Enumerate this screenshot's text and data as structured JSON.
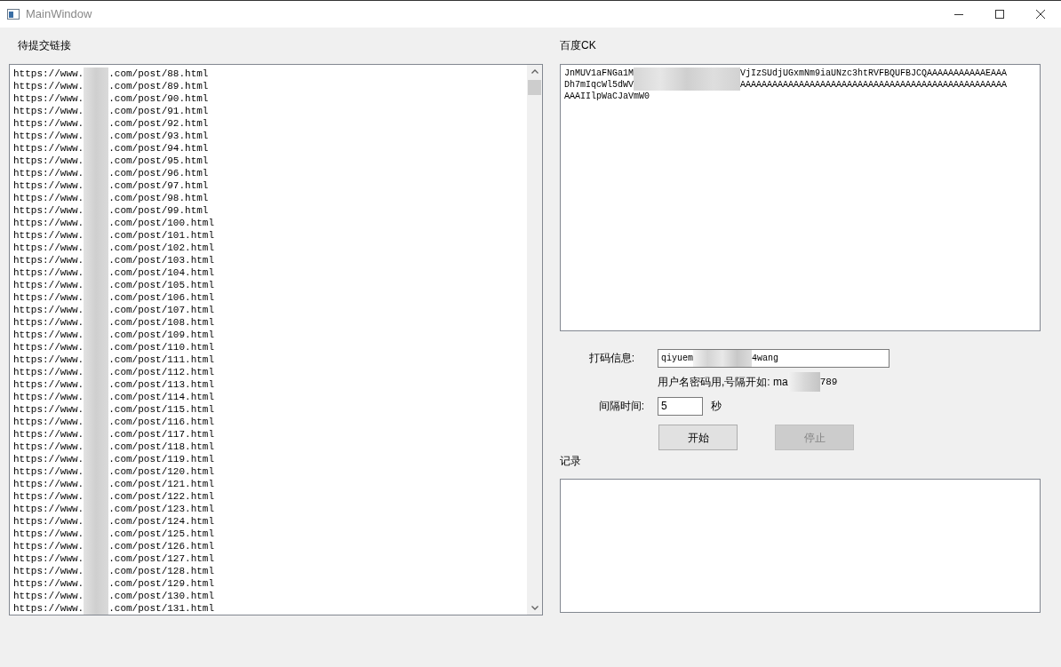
{
  "window": {
    "title": "MainWindow"
  },
  "links_panel": {
    "label": "待提交链接",
    "lines": [
      {
        "before": "https://www.",
        "after": ".com/post/88.html"
      },
      {
        "before": "https://www.",
        "after": ".com/post/89.html"
      },
      {
        "before": "https://www.",
        "after": ".com/post/90.html"
      },
      {
        "before": "https://www.",
        "after": ".com/post/91.html"
      },
      {
        "before": "https://www.",
        "after": ".com/post/92.html"
      },
      {
        "before": "https://www.",
        "after": ".com/post/93.html"
      },
      {
        "before": "https://www.",
        "after": ".com/post/94.html"
      },
      {
        "before": "https://www.",
        "after": ".com/post/95.html"
      },
      {
        "before": "https://www.",
        "after": ".com/post/96.html"
      },
      {
        "before": "https://www.",
        "after": ".com/post/97.html"
      },
      {
        "before": "https://www.",
        "after": ".com/post/98.html"
      },
      {
        "before": "https://www.",
        "after": ".com/post/99.html"
      },
      {
        "before": "https://www.",
        "after": ".com/post/100.html"
      },
      {
        "before": "https://www.",
        "after": ".com/post/101.html"
      },
      {
        "before": "https://www.",
        "after": ".com/post/102.html"
      },
      {
        "before": "https://www.",
        "after": ".com/post/103.html"
      },
      {
        "before": "https://www.",
        "after": ".com/post/104.html"
      },
      {
        "before": "https://www.",
        "after": ".com/post/105.html"
      },
      {
        "before": "https://www.",
        "after": ".com/post/106.html"
      },
      {
        "before": "https://www.",
        "after": ".com/post/107.html"
      },
      {
        "before": "https://www.",
        "after": ".com/post/108.html"
      },
      {
        "before": "https://www.",
        "after": ".com/post/109.html"
      },
      {
        "before": "https://www.",
        "after": ".com/post/110.html"
      },
      {
        "before": "https://www.",
        "after": ".com/post/111.html"
      },
      {
        "before": "https://www.",
        "after": ".com/post/112.html"
      },
      {
        "before": "https://www.",
        "after": ".com/post/113.html"
      },
      {
        "before": "https://www.",
        "after": ".com/post/114.html"
      },
      {
        "before": "https://www.",
        "after": ".com/post/115.html"
      },
      {
        "before": "https://www.",
        "after": ".com/post/116.html"
      },
      {
        "before": "https://www.",
        "after": ".com/post/117.html"
      },
      {
        "before": "https://www.",
        "after": ".com/post/118.html"
      },
      {
        "before": "https://www.",
        "after": ".com/post/119.html"
      },
      {
        "before": "https://www.",
        "after": ".com/post/120.html"
      },
      {
        "before": "https://www.",
        "after": ".com/post/121.html"
      },
      {
        "before": "https://www.",
        "after": ".com/post/122.html"
      },
      {
        "before": "https://www.",
        "after": ".com/post/123.html"
      },
      {
        "before": "https://www.",
        "after": ".com/post/124.html"
      },
      {
        "before": "https://www.",
        "after": ".com/post/125.html"
      },
      {
        "before": "https://www.",
        "after": ".com/post/126.html"
      },
      {
        "before": "https://www.",
        "after": ".com/post/127.html"
      },
      {
        "before": "https://www.",
        "after": ".com/post/128.html"
      },
      {
        "before": "https://www.",
        "after": ".com/post/129.html"
      },
      {
        "before": "https://www.",
        "after": ".com/post/130.html"
      },
      {
        "before": "https://www.",
        "after": ".com/post/131.html"
      }
    ]
  },
  "ck_panel": {
    "label": "百度CK",
    "lines": [
      {
        "before": "JnMUV1aFNGa1M",
        "after": "VjIzSUdjUGxmNm9iaUNzc3htRVFBQUFBJCQAAAAAAAAAAAEAAA"
      },
      {
        "before": "Dh7mIqcWl5dWV",
        "after": "AAAAAAAAAAAAAAAAAAAAAAAAAAAAAAAAAAAAAAAAAAAAAAAAAA"
      },
      {
        "before": "AAAIIlpWaCJaVmW0"
      }
    ]
  },
  "captcha": {
    "label": "打码信息:",
    "value_before": "qiyuem",
    "value_after": "4wang",
    "hint_before": "用户名密码用,号隔开如: ma",
    "hint_after": "789"
  },
  "interval": {
    "label": "间隔时间:",
    "value": "5",
    "unit": "秒"
  },
  "buttons": [
    {
      "label": "开始",
      "disabled": false
    },
    {
      "label": "停止",
      "disabled": true
    }
  ],
  "log": {
    "label": "记录"
  }
}
